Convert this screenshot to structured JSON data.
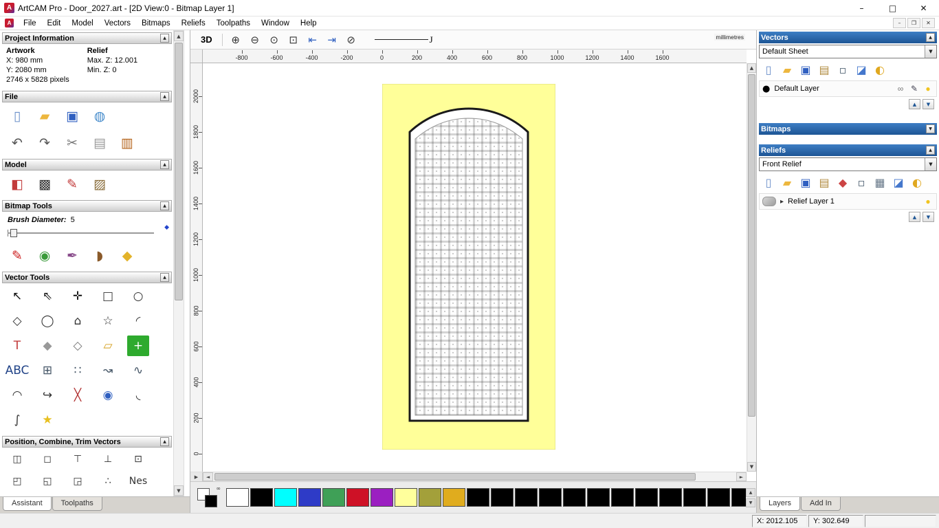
{
  "window": {
    "title": "ArtCAM Pro - Door_2027.art - [2D View:0 - Bitmap Layer 1]",
    "app_initial": "A"
  },
  "chrome": {
    "minimize": "–",
    "maximize": "□",
    "close": "✕",
    "mdi_minimize": "–",
    "mdi_restore": "❐",
    "mdi_close": "✕"
  },
  "icons": {
    "dropdown": "▼",
    "scroll_up": "▲",
    "scroll_down": "▼",
    "scroll_left": "◄",
    "scroll_right": "►",
    "pan_corner": "▶",
    "collapse_up": "▲",
    "collapse_down": "▼",
    "layer_up": "▲",
    "layer_down": "▼",
    "link": "∞",
    "layer_swatch": "●",
    "expander": "▸"
  },
  "menu": {
    "items": [
      "File",
      "Edit",
      "Model",
      "Vectors",
      "Bitmaps",
      "Reliefs",
      "Toolpaths",
      "Window",
      "Help"
    ]
  },
  "left_panel": {
    "project_info": {
      "title": "Project Information",
      "artwork_heading": "Artwork",
      "relief_heading": "Relief",
      "artwork_x": "X: 980 mm",
      "artwork_y": "Y: 2080 mm",
      "relief_max": "Max. Z: 12.001",
      "relief_min": "Min. Z: 0",
      "pixels": "2746 x 5828 pixels"
    },
    "file": {
      "title": "File",
      "row1": [
        {
          "n": "new-model-icon",
          "g": "▯",
          "c": "#6b8fc9"
        },
        {
          "n": "open-model-icon",
          "g": "▰",
          "c": "#edb73e"
        },
        {
          "n": "save-model-icon",
          "g": "▣",
          "c": "#2f5fc0"
        },
        {
          "n": "export-model-icon",
          "g": "◍",
          "c": "#3f87c9"
        }
      ],
      "row2": [
        {
          "n": "undo-icon",
          "g": "↶",
          "c": "#555555"
        },
        {
          "n": "redo-icon",
          "g": "↷",
          "c": "#555555"
        },
        {
          "n": "cut-icon",
          "g": "✂",
          "c": "#777777"
        },
        {
          "n": "copy-icon",
          "g": "▤",
          "c": "#999999"
        },
        {
          "n": "paste-icon",
          "g": "▥",
          "c": "#b5651d"
        }
      ]
    },
    "model": {
      "title": "Model",
      "icons": [
        {
          "n": "set-model-size-icon",
          "g": "◧",
          "c": "#c23b3b"
        },
        {
          "n": "model-lighting-icon",
          "g": "▩",
          "c": "#333333"
        },
        {
          "n": "sculpting-tools-icon",
          "g": "✎",
          "c": "#c23b3b"
        },
        {
          "n": "load-image-icon",
          "g": "▨",
          "c": "#8a6d3b"
        }
      ]
    },
    "bitmap_tools": {
      "title": "Bitmap Tools",
      "brush_label": "Brush Diameter:",
      "brush_value": "5",
      "icons": [
        {
          "n": "paint-brush-icon",
          "g": "✎",
          "c": "#cc2222"
        },
        {
          "n": "paint-selective-icon",
          "g": "◉",
          "c": "#3a9a3a"
        },
        {
          "n": "draw-pen-icon",
          "g": "✒",
          "c": "#884a8a"
        },
        {
          "n": "colour-picker-icon",
          "g": "◗",
          "c": "#8a5a2a"
        },
        {
          "n": "flood-fill-icon",
          "g": "◆",
          "c": "#e3b32a"
        }
      ]
    },
    "vector_tools": {
      "title": "Vector Tools",
      "icons": [
        {
          "n": "select-vectors-icon",
          "g": "↖",
          "c": "#111111"
        },
        {
          "n": "node-editing-icon",
          "g": "⇖",
          "c": "#111111"
        },
        {
          "n": "transform-vectors-icon",
          "g": "✛",
          "c": "#111111"
        },
        {
          "n": "create-rectangle-icon",
          "g": "□",
          "c": "#333333"
        },
        {
          "n": "create-circle-icon",
          "g": "○",
          "c": "#333333"
        },
        {
          "n": "create-polyline-icon",
          "g": "◇",
          "c": "#333333"
        },
        {
          "n": "create-ellipse-icon",
          "g": "◯",
          "c": "#333333"
        },
        {
          "n": "create-polygon-icon",
          "g": "⌂",
          "c": "#333333"
        },
        {
          "n": "create-star-icon",
          "g": "☆",
          "c": "#333333"
        },
        {
          "n": "create-arc-icon",
          "g": "◜",
          "c": "#333333"
        },
        {
          "n": "create-text-icon",
          "g": "T",
          "c": "#c23b3b"
        },
        {
          "n": "mirror-vectors-icon",
          "g": "◆",
          "c": "#999999"
        },
        {
          "n": "offset-vectors-icon",
          "g": "◇",
          "c": "#777777"
        },
        {
          "n": "measure-tool-icon",
          "g": "▱",
          "c": "#d5a020"
        },
        {
          "n": "paste-special-icon",
          "g": "+",
          "c": "#ffffff",
          "bg": "#2eaa2e"
        },
        {
          "n": "text-on-curve-icon",
          "g": "ABC",
          "c": "#224488"
        },
        {
          "n": "grid-copy-icon",
          "g": "⊞",
          "c": "#445566"
        },
        {
          "n": "block-copy-icon",
          "g": "∷",
          "c": "#445566"
        },
        {
          "n": "copy-along-curve-icon",
          "g": "↝",
          "c": "#445566"
        },
        {
          "n": "blend-spline-icon",
          "g": "∿",
          "c": "#445566"
        },
        {
          "n": "fit-arcs-icon",
          "g": "◠",
          "c": "#333333"
        },
        {
          "n": "join-vectors-icon",
          "g": "↪",
          "c": "#333333"
        },
        {
          "n": "trim-vectors-icon",
          "g": "╳",
          "c": "#b03030"
        },
        {
          "n": "interactive-lens-icon",
          "g": "◉",
          "c": "#2f5fc0"
        },
        {
          "n": "fillet-icon",
          "g": "◟",
          "c": "#333333"
        },
        {
          "n": "section-profile-icon",
          "g": "∫",
          "c": "#333333"
        },
        {
          "n": "create-star-shape-icon",
          "g": "★",
          "c": "#e8c020"
        }
      ]
    },
    "position_tools": {
      "title": "Position, Combine, Trim Vectors",
      "icons": [
        {
          "n": "center-in-page-icon",
          "g": "◫",
          "c": "#333333"
        },
        {
          "n": "align-objects-icon",
          "g": "◻",
          "c": "#333333"
        },
        {
          "n": "align-top-icon",
          "g": "⊤",
          "c": "#333333"
        },
        {
          "n": "align-bottom-icon",
          "g": "⊥",
          "c": "#333333"
        },
        {
          "n": "align-centers-icon",
          "g": "⊡",
          "c": "#333333"
        },
        {
          "n": "weld-vectors-icon",
          "g": "◰",
          "c": "#333333"
        },
        {
          "n": "subtract-vectors-icon",
          "g": "◱",
          "c": "#333333"
        },
        {
          "n": "slice-vectors-icon",
          "g": "◲",
          "c": "#333333"
        },
        {
          "n": "scatter-copies-icon",
          "g": "∴",
          "c": "#333333"
        },
        {
          "n": "nesting-icon",
          "g": "Nes",
          "c": "#333333"
        }
      ]
    },
    "tabs": {
      "assistant": "Assistant",
      "toolpaths": "Toolpaths"
    }
  },
  "canvas": {
    "toolbar": {
      "view3d": "3D",
      "icons": [
        {
          "n": "zoom-in-icon",
          "g": "⊕",
          "c": "#333333"
        },
        {
          "n": "zoom-out-icon",
          "g": "⊖",
          "c": "#333333"
        },
        {
          "n": "zoom-objects-icon",
          "g": "⊙",
          "c": "#333333"
        },
        {
          "n": "zoom-box-icon",
          "g": "⊡",
          "c": "#333333"
        },
        {
          "n": "snap-left-icon",
          "g": "⇤",
          "c": "#2f5fc0"
        },
        {
          "n": "snap-right-icon",
          "g": "⇥",
          "c": "#2f5fc0"
        },
        {
          "n": "zoom-previous-icon",
          "g": "⊘",
          "c": "#333333"
        }
      ],
      "line_label": "J"
    },
    "hruler": {
      "ticks": [
        "-800",
        "-600",
        "-400",
        "-200",
        "0",
        "200",
        "400",
        "600",
        "800",
        "1000",
        "1200",
        "1400",
        "1600"
      ],
      "unit": "millimetres"
    },
    "vruler": {
      "ticks": [
        "2000",
        "1800",
        "1600",
        "1400",
        "1200",
        "1000",
        "800",
        "600",
        "400",
        "200",
        "0"
      ]
    },
    "door_color": "#ffff99"
  },
  "palette": {
    "colors": [
      "#ffffff",
      "#000000",
      "#00ffff",
      "#2e3bc7",
      "#3fa057",
      "#ce1126",
      "#9b1fc1",
      "#ffff9c",
      "#a3a03a",
      "#e0ac1e",
      "#000000",
      "#000000",
      "#000000",
      "#000000",
      "#000000",
      "#000000",
      "#000000",
      "#000000",
      "#000000",
      "#000000",
      "#000000",
      "#000000"
    ]
  },
  "right_panel": {
    "vectors": {
      "title": "Vectors",
      "sheet": "Default Sheet",
      "toolbar": [
        {
          "n": "new-vector-sheet-icon",
          "g": "▯",
          "c": "#6b8fc9"
        },
        {
          "n": "open-vectors-icon",
          "g": "▰",
          "c": "#edb73e"
        },
        {
          "n": "save-vectors-icon",
          "g": "▣",
          "c": "#2f5fc0"
        },
        {
          "n": "import-vectors-icon",
          "g": "▤",
          "c": "#b08a3e"
        },
        {
          "n": "new-vector-layer-icon",
          "g": "▫",
          "c": "#556677"
        },
        {
          "n": "delete-vector-layer-icon",
          "g": "◪",
          "c": "#4477cc"
        },
        {
          "n": "toggle-all-visibility-icon",
          "g": "◐",
          "c": "#e0a820"
        }
      ],
      "layer_name": "Default Layer",
      "layer_color": "#000000",
      "layer_icons": [
        {
          "n": "layer-snap-icon",
          "g": "∞",
          "c": "#777777"
        },
        {
          "n": "layer-edit-icon",
          "g": "✎",
          "c": "#444455"
        },
        {
          "n": "layer-visibility-icon",
          "g": "●",
          "c": "#f0c420"
        }
      ]
    },
    "bitmaps": {
      "title": "Bitmaps"
    },
    "reliefs": {
      "title": "Reliefs",
      "selected": "Front Relief",
      "toolbar": [
        {
          "n": "new-relief-icon",
          "g": "▯",
          "c": "#6b8fc9"
        },
        {
          "n": "open-relief-icon",
          "g": "▰",
          "c": "#edb73e"
        },
        {
          "n": "save-relief-icon",
          "g": "▣",
          "c": "#2f5fc0"
        },
        {
          "n": "import-relief-icon",
          "g": "▤",
          "c": "#b08a3e"
        },
        {
          "n": "relief-shape-icon",
          "g": "◆",
          "c": "#cc4444"
        },
        {
          "n": "new-relief-layer-icon",
          "g": "▫",
          "c": "#556677"
        },
        {
          "n": "relief-grayscale-icon",
          "g": "▦",
          "c": "#667788"
        },
        {
          "n": "delete-relief-layer-icon",
          "g": "◪",
          "c": "#4477cc"
        },
        {
          "n": "toggle-relief-visibility-icon",
          "g": "◐",
          "c": "#e0a820"
        }
      ],
      "layer_name": "Relief Layer 1",
      "layer_icons": [
        {
          "n": "relief-visibility-icon",
          "g": "●",
          "c": "#f0c420"
        }
      ]
    },
    "tabs": {
      "layers": "Layers",
      "addin": "Add In"
    }
  },
  "status": {
    "x": "X: 2012.105",
    "y": "Y: 302.649"
  }
}
